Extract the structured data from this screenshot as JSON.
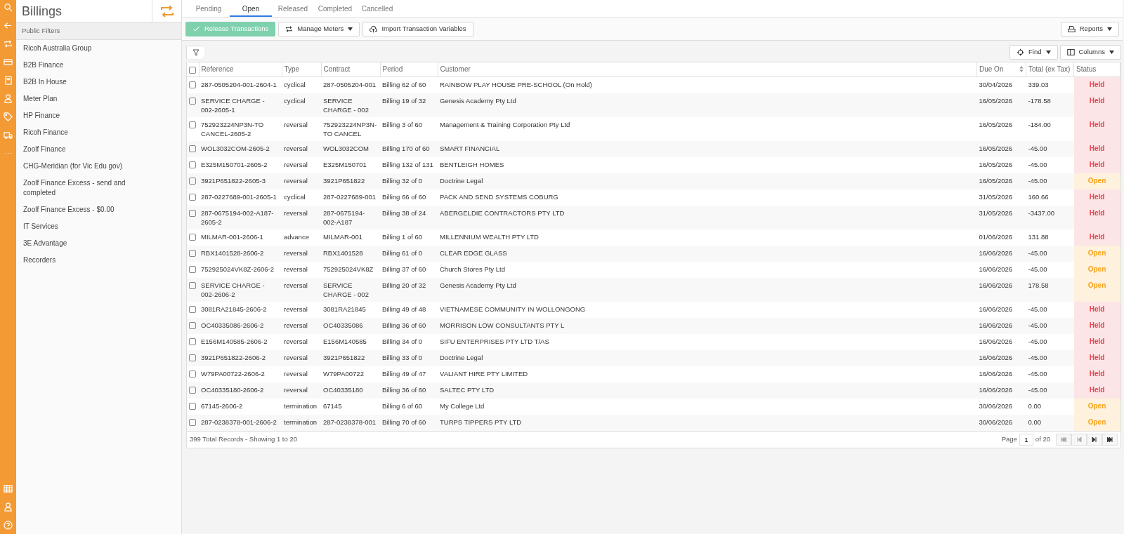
{
  "sidebar": {
    "title": "Billings",
    "section": "Public Filters",
    "items": [
      "Ricoh Australia Group",
      "B2B Finance",
      "B2B In House",
      "Meter Plan",
      "HP Finance",
      "Ricoh Finance",
      "Zoolf Finance",
      "CHG-Meridian (for Vic Edu gov)",
      "Zoolf Finance Excess - send and completed",
      "Zoolf Finance Excess - $0.00",
      "IT Services",
      "3E Advantage",
      "Recorders"
    ]
  },
  "tabs": [
    {
      "label": "Pending",
      "selected": false
    },
    {
      "label": "Open",
      "selected": true
    },
    {
      "label": "Released",
      "selected": false
    },
    {
      "label": "Completed",
      "selected": false
    },
    {
      "label": "Cancelled",
      "selected": false
    }
  ],
  "toolbar": [
    {
      "label": "Release Transactions",
      "kind": "check",
      "dropdown": false
    },
    {
      "label": "Manage Meters",
      "kind": "repeat",
      "dropdown": true
    },
    {
      "label": "Import Transaction Variables",
      "kind": "upload",
      "dropdown": false
    }
  ],
  "reports_button": {
    "label": "Reports"
  },
  "find_button": {
    "label": "Find"
  },
  "columns_button": {
    "label": "Columns"
  },
  "table": {
    "columns": [
      {
        "label": "Reference",
        "sortable": false
      },
      {
        "label": "Type",
        "sortable": false
      },
      {
        "label": "Contract",
        "sortable": false
      },
      {
        "label": "Period",
        "sortable": false
      },
      {
        "label": "Customer",
        "sortable": false
      },
      {
        "label": "Due On",
        "sortable": true
      },
      {
        "label": "Total (ex Tax)",
        "sortable": false
      },
      {
        "label": "Status",
        "sortable": false
      }
    ],
    "select_all": {
      "checked": false
    },
    "rows": [
      {
        "checked": false,
        "reference": "287-0505204-001-2604-1",
        "type": "cyclical",
        "contract": "287-0505204-001",
        "period": "Billing 62 of 60",
        "customer": "RAINBOW PLAY HOUSE PRE-SCHOOL (On Hold)",
        "due_on": "30/04/2026",
        "total": "339.03",
        "status": {
          "text": "Held",
          "color": "#e8424f"
        }
      },
      {
        "checked": false,
        "reference": "SERVICE CHARGE - 002-2605-1",
        "type": "cyclical",
        "contract": "SERVICE CHARGE - 002",
        "period": "Billing 19 of 32",
        "customer": "Genesis Academy Pty Ltd",
        "due_on": "16/05/2026",
        "total": "-178.58",
        "status": {
          "text": "Held",
          "color": "#e8424f"
        }
      },
      {
        "checked": false,
        "reference": "752923224NP3N-TO CANCEL-2605-2",
        "type": "reversal",
        "contract": "752923224NP3N-TO CANCEL",
        "period": "Billing 3 of 60",
        "customer": "Management & Training Corporation Pty Ltd",
        "due_on": "16/05/2026",
        "total": "-184.00",
        "status": {
          "text": "Held",
          "color": "#e8424f"
        }
      },
      {
        "checked": false,
        "reference": "WOL3032COM-2605-2",
        "type": "reversal",
        "contract": "WOL3032COM",
        "period": "Billing 170 of 60",
        "customer": "SMART FINANCIAL",
        "due_on": "16/05/2026",
        "total": "-45.00",
        "status": {
          "text": "Held",
          "color": "#e8424f"
        }
      },
      {
        "checked": false,
        "reference": "E325M150701-2605-2",
        "type": "reversal",
        "contract": "E325M150701",
        "period": "Billing 132 of 131",
        "customer": "BENTLEIGH HOMES",
        "due_on": "16/05/2026",
        "total": "-45.00",
        "status": {
          "text": "Held",
          "color": "#e8424f"
        }
      },
      {
        "checked": false,
        "reference": "3921P651822-2605-3",
        "type": "reversal",
        "contract": "3921P651822",
        "period": "Billing 32 of 0",
        "customer": "Doctrine Legal",
        "due_on": "16/05/2026",
        "total": "-45.00",
        "status": {
          "text": "Open",
          "color": "#f7a21b"
        }
      },
      {
        "checked": false,
        "reference": "287-0227689-001-2605-1",
        "type": "cyclical",
        "contract": "287-0227689-001",
        "period": "Billing 66 of 60",
        "customer": "PACK AND SEND SYSTEMS COBURG",
        "due_on": "31/05/2026",
        "total": "160.66",
        "status": {
          "text": "Held",
          "color": "#e8424f"
        }
      },
      {
        "checked": false,
        "reference": "287-0675194-002-A187-2605-2",
        "type": "reversal",
        "contract": "287-0675194-002-A187",
        "period": "Billing 38 of 24",
        "customer": "ABERGELDIE CONTRACTORS PTY LTD",
        "due_on": "31/05/2026",
        "total": "-3437.00",
        "status": {
          "text": "Held",
          "color": "#e8424f"
        }
      },
      {
        "checked": false,
        "reference": "MILMAR-001-2606-1",
        "type": "advance",
        "contract": "MILMAR-001",
        "period": "Billing 1 of 60",
        "customer": "MILLENNIUM WEALTH PTY LTD",
        "due_on": "01/06/2026",
        "total": "131.88",
        "status": {
          "text": "Held",
          "color": "#e8424f"
        }
      },
      {
        "checked": false,
        "reference": "RBX1401528-2606-2",
        "type": "reversal",
        "contract": "RBX1401528",
        "period": "Billing 61 of 0",
        "customer": "CLEAR EDGE GLASS",
        "due_on": "16/06/2026",
        "total": "-45.00",
        "status": {
          "text": "Open",
          "color": "#f7a21b"
        }
      },
      {
        "checked": false,
        "reference": "752925024VK8Z-2606-2",
        "type": "reversal",
        "contract": "752925024VK8Z",
        "period": "Billing 37 of 60",
        "customer": "Church Stores Pty Ltd",
        "due_on": "16/06/2026",
        "total": "-45.00",
        "status": {
          "text": "Open",
          "color": "#f7a21b"
        }
      },
      {
        "checked": false,
        "reference": "SERVICE CHARGE - 002-2606-2",
        "type": "reversal",
        "contract": "SERVICE CHARGE - 002",
        "period": "Billing 20 of 32",
        "customer": "Genesis Academy Pty Ltd",
        "due_on": "16/06/2026",
        "total": "178.58",
        "status": {
          "text": "Open",
          "color": "#f7a21b"
        }
      },
      {
        "checked": false,
        "reference": "3081RA21845-2606-2",
        "type": "reversal",
        "contract": "3081RA21845",
        "period": "Billing 49 of 48",
        "customer": "VIETNAMESE COMMUNITY IN WOLLONGONG",
        "due_on": "16/06/2026",
        "total": "-45.00",
        "status": {
          "text": "Held",
          "color": "#e8424f"
        }
      },
      {
        "checked": false,
        "reference": "OC40335086-2606-2",
        "type": "reversal",
        "contract": "OC40335086",
        "period": "Billing 36 of 60",
        "customer": "MORRISON LOW CONSULTANTS PTY L",
        "due_on": "16/06/2026",
        "total": "-45.00",
        "status": {
          "text": "Held",
          "color": "#e8424f"
        }
      },
      {
        "checked": false,
        "reference": "E156M140585-2606-2",
        "type": "reversal",
        "contract": "E156M140585",
        "period": "Billing 34 of 0",
        "customer": "SIFU ENTERPRISES PTY LTD T/AS",
        "due_on": "16/06/2026",
        "total": "-45.00",
        "status": {
          "text": "Held",
          "color": "#e8424f"
        }
      },
      {
        "checked": false,
        "reference": "3921P651822-2606-2",
        "type": "reversal",
        "contract": "3921P651822",
        "period": "Billing 33 of 0",
        "customer": "Doctrine Legal",
        "due_on": "16/06/2026",
        "total": "-45.00",
        "status": {
          "text": "Held",
          "color": "#e8424f"
        }
      },
      {
        "checked": false,
        "reference": "W79PA00722-2606-2",
        "type": "reversal",
        "contract": "W79PA00722",
        "period": "Billing 49 of 47",
        "customer": "VALIANT HIRE PTY LIMITED",
        "due_on": "16/06/2026",
        "total": "-45.00",
        "status": {
          "text": "Held",
          "color": "#e8424f"
        }
      },
      {
        "checked": false,
        "reference": "OC40335180-2606-2",
        "type": "reversal",
        "contract": "OC40335180",
        "period": "Billing 36 of 60",
        "customer": "SALTEC PTY LTD",
        "due_on": "16/06/2026",
        "total": "-45.00",
        "status": {
          "text": "Held",
          "color": "#e8424f"
        }
      },
      {
        "checked": false,
        "reference": "67145-2606-2",
        "type": "termination",
        "contract": "67145",
        "period": "Billing 6 of 60",
        "customer": "My College Ltd",
        "due_on": "30/06/2026",
        "total": "0.00",
        "status": {
          "text": "Open",
          "color": "#f7a21b"
        }
      },
      {
        "checked": false,
        "reference": "287-0238378-001-2606-2",
        "type": "termination",
        "contract": "287-0238378-001",
        "period": "Billing 70 of 60",
        "customer": "TURPS TIPPERS PTY LTD",
        "due_on": "30/06/2026",
        "total": "0.00",
        "status": {
          "text": "Open",
          "color": "#f7a21b"
        }
      }
    ]
  },
  "footer": {
    "summary": "399 Total Records - Showing 1 to 20",
    "page_label": "Page",
    "page_value": "1",
    "page_total": "of 20"
  }
}
